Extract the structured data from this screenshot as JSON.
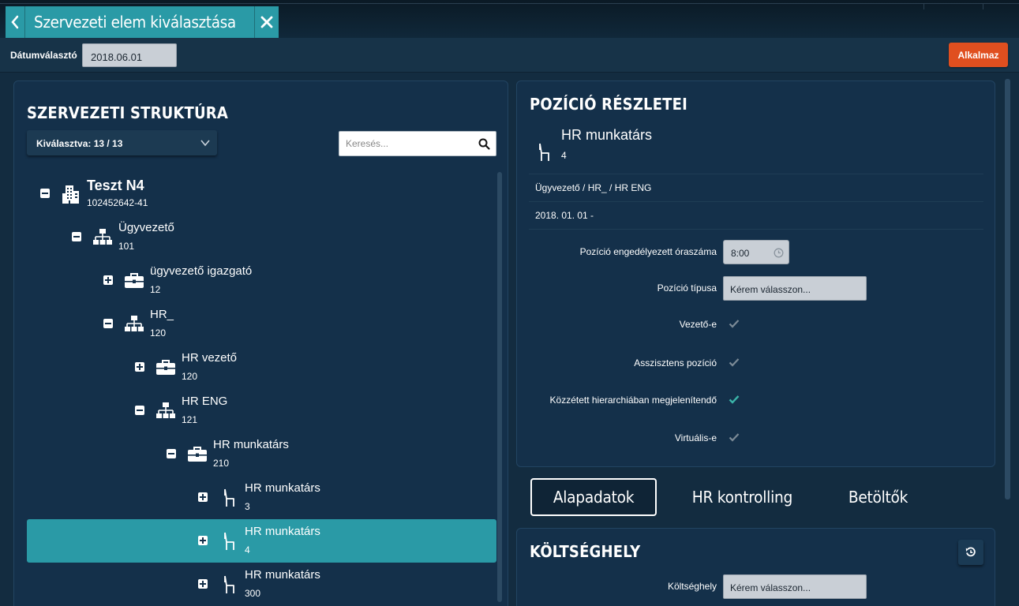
{
  "header": {
    "title": "Szervezeti elem kiválasztása",
    "back_icon": "chevron-left-icon",
    "close_icon": "close-icon"
  },
  "toolbar": {
    "date_label": "Dátumválasztó",
    "date_value": "2018.06.01",
    "apply_label": "Alkalmaz"
  },
  "structure": {
    "heading": "SZERVEZETI STRUKTÚRA",
    "selected_label": "Kiválasztva: 13 / 13",
    "search_placeholder": "Keresés...",
    "nodes": [
      {
        "name": "Teszt N4",
        "code": "102452642-41",
        "icon": "building-icon",
        "toggle": "collapse",
        "level": 0
      },
      {
        "name": "Ügyvezető",
        "code": "101",
        "icon": "org-unit-icon",
        "toggle": "collapse",
        "level": 1
      },
      {
        "name": "ügyvezető igazgató",
        "code": "12",
        "icon": "briefcase-icon",
        "toggle": "expand",
        "level": 2
      },
      {
        "name": "HR_",
        "code": "120",
        "icon": "org-unit-icon",
        "toggle": "collapse",
        "level": 2
      },
      {
        "name": "HR vezető",
        "code": "120",
        "icon": "briefcase-icon",
        "toggle": "expand",
        "level": 3
      },
      {
        "name": "HR ENG",
        "code": "121",
        "icon": "org-unit-icon",
        "toggle": "collapse",
        "level": 3
      },
      {
        "name": "HR munkatárs",
        "code": "210",
        "icon": "briefcase-icon",
        "toggle": "collapse",
        "level": 4
      },
      {
        "name": "HR munkatárs",
        "code": "3",
        "icon": "chair-icon",
        "toggle": "expand",
        "level": 5
      },
      {
        "name": "HR munkatárs",
        "code": "4",
        "icon": "chair-icon",
        "toggle": "expand",
        "level": 5,
        "selected": true
      },
      {
        "name": "HR munkatárs",
        "code": "300",
        "icon": "chair-icon",
        "toggle": "expand",
        "level": 5
      }
    ]
  },
  "details": {
    "heading": "POZÍCIÓ RÉSZLETEI",
    "position_name": "HR munkatárs",
    "position_code": "4",
    "path": "Ügyvezető / HR_ / HR ENG",
    "validity": "2018. 01. 01 -",
    "fields": {
      "hours_label": "Pozíció engedélyezett óraszáma",
      "hours_value": "8:00",
      "type_label": "Pozíció típusa",
      "type_placeholder": "Kérem válasszon...",
      "leader_label": "Vezető-e",
      "assistant_label": "Asszisztens pozíció",
      "published_label": "Közzétett hierarchiában megjelenítendő",
      "virtual_label": "Virtuális-e"
    },
    "checks": {
      "leader": false,
      "assistant": false,
      "published": true,
      "virtual": false
    }
  },
  "tabs": [
    {
      "label": "Alapadatok",
      "active": true
    },
    {
      "label": "HR kontrolling",
      "active": false
    },
    {
      "label": "Betöltők",
      "active": false
    }
  ],
  "cost": {
    "heading": "KÖLTSÉGHELY",
    "field_label": "Költséghely",
    "placeholder": "Kérem válasszon...",
    "reset_icon": "history-reset-icon"
  },
  "colors": {
    "accent": "#2a9aa6",
    "apply": "#e04f1f",
    "background": "#132c40",
    "panel": "#14304a",
    "check_active": "#3bb3a8",
    "check_inactive": "#7b8a96"
  }
}
